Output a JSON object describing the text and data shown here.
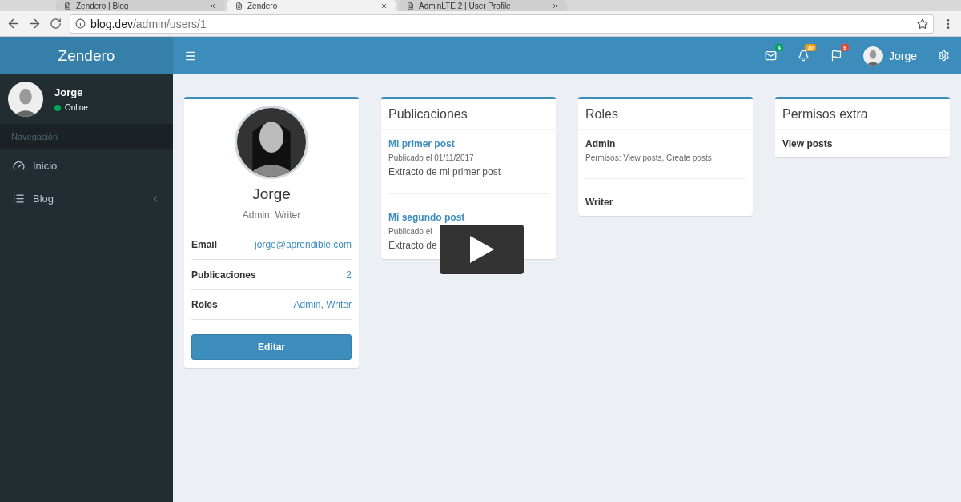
{
  "browser": {
    "tabs": [
      {
        "title": "Zendero | Blog",
        "selected": false
      },
      {
        "title": "Zendero",
        "selected": true
      },
      {
        "title": "AdminLTE 2 | User Profile",
        "selected": false
      }
    ],
    "url_host": "blog.dev",
    "url_path": "/admin/users/1"
  },
  "header": {
    "logo": "Zendero",
    "notifications": [
      {
        "kind": "mail",
        "count": "4",
        "color": "#00a65a"
      },
      {
        "kind": "bell",
        "count": "10",
        "color": "#f39c12"
      },
      {
        "kind": "flag",
        "count": "9",
        "color": "#dd4b39"
      }
    ],
    "user": "Jorge"
  },
  "sidebar": {
    "user": {
      "name": "Jorge",
      "status": "Online",
      "color": "#00a65a"
    },
    "section": "Navegación",
    "items": [
      {
        "kind": "dashboard",
        "label": "Inicio",
        "expandable": false
      },
      {
        "kind": "list",
        "label": "Blog",
        "expandable": true
      }
    ]
  },
  "profile": {
    "name": "Jorge",
    "roles": "Admin, Writer",
    "rows": [
      {
        "label": "Email",
        "value": "jorge@aprendible.com"
      },
      {
        "label": "Publicaciones",
        "value": "2"
      },
      {
        "label": "Roles",
        "value": "Admin, Writer"
      }
    ],
    "button": "Editar"
  },
  "posts": {
    "title": "Publicaciones",
    "items": [
      {
        "title": "Mi primer post",
        "date": "Publicado el 01/11/2017",
        "excerpt": "Extracto de mi primer post"
      },
      {
        "title": "Mi segundo post",
        "date": "Publicado el",
        "excerpt": "Extracto de"
      }
    ]
  },
  "roles": {
    "title": "Roles",
    "items": [
      {
        "name": "Admin",
        "permissions": "Permisos: View posts, Create posts"
      },
      {
        "name": "Writer"
      }
    ]
  },
  "extra_permissions": {
    "title": "Permisos extra",
    "items": [
      "View posts"
    ]
  },
  "video": {
    "play_button": true
  }
}
